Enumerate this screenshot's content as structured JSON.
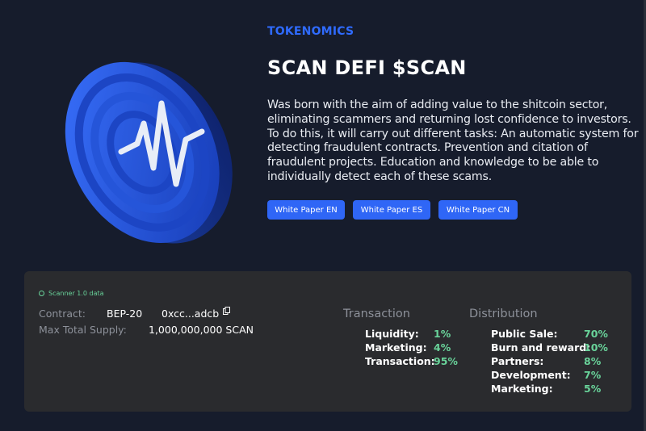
{
  "hero": {
    "eyebrow": "TOKENOMICS",
    "title": "SCAN DEFI $SCAN",
    "description": "Was born with the aim of adding value to the shitcoin sector, eliminating scammers and returning lost confidence to investors. To do this, it will carry out different tasks: An automatic system for detecting fraudulent contracts. Prevention and citation of fraudulent projects. Education and knowledge to be able to individually detect each of these scams.",
    "buttons": [
      "White Paper EN",
      "White Paper ES",
      "White Paper CN"
    ]
  },
  "panel": {
    "badge": "Scanner 1.0 data",
    "contract_label": "Contract:",
    "contract_network": "BEP-20",
    "contract_address": "0xcc...adcb",
    "supply_label": "Max Total Supply:",
    "supply_value": "1,000,000,000 SCAN",
    "transaction": {
      "title": "Transaction",
      "rows": [
        {
          "label": "Liquidity:",
          "value": "1%"
        },
        {
          "label": "Marketing:",
          "value": "4%"
        },
        {
          "label": "Transaction:",
          "value": "95%"
        }
      ]
    },
    "distribution": {
      "title": "Distribution",
      "rows": [
        {
          "label": "Public Sale:",
          "value": "70%"
        },
        {
          "label": "Burn and reward:",
          "value": "10%"
        },
        {
          "label": "Partners:",
          "value": "8%"
        },
        {
          "label": "Development:",
          "value": "7%"
        },
        {
          "label": "Marketing:",
          "value": "5%"
        }
      ]
    }
  },
  "colors": {
    "accent": "#2f66f6",
    "positive": "#69d39a",
    "background": "#161c2c",
    "panel": "#2a2b2e"
  },
  "icons": {
    "coin": "scan-coin-logo",
    "copy": "copy-icon",
    "status": "status-dot-icon"
  }
}
